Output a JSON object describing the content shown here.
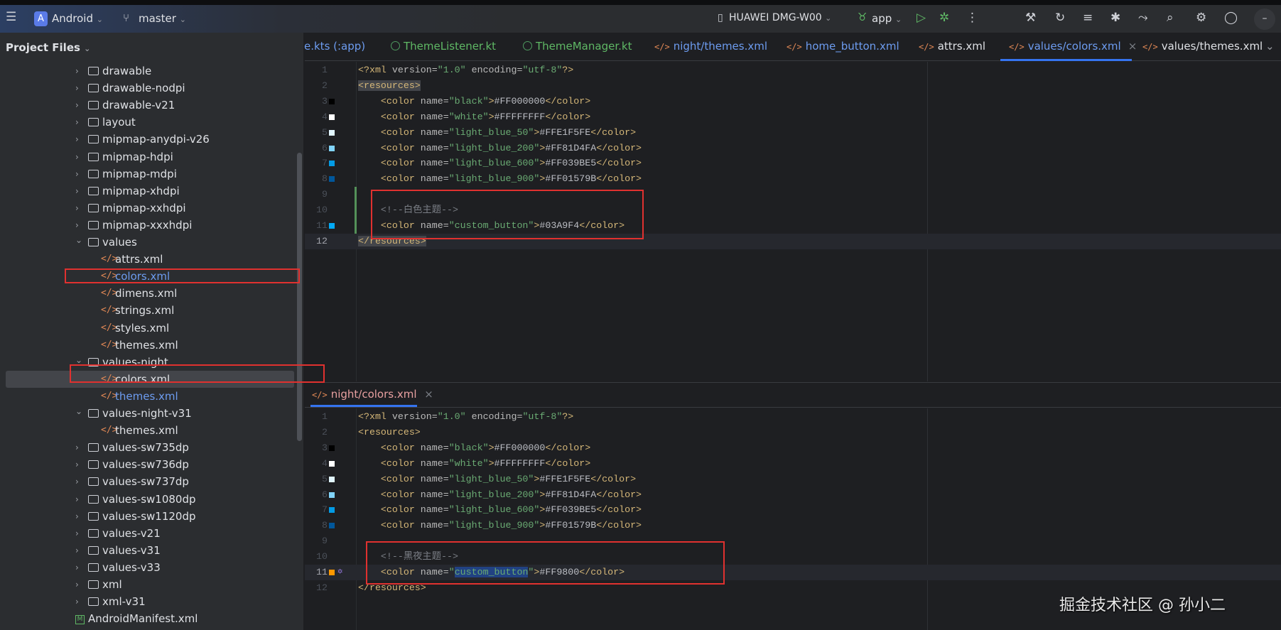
{
  "toolbar": {
    "project_badge": "A",
    "project": "Android",
    "branch": "master",
    "device": "HUAWEI DMG-W00",
    "run_config": "app",
    "more": "⋮"
  },
  "sidebar": {
    "title": "Project Files",
    "items": [
      {
        "label": "drawable",
        "type": "folder",
        "depth": 2
      },
      {
        "label": "drawable-nodpi",
        "type": "folder",
        "depth": 2
      },
      {
        "label": "drawable-v21",
        "type": "folder",
        "depth": 2
      },
      {
        "label": "layout",
        "type": "folder",
        "depth": 2
      },
      {
        "label": "mipmap-anydpi-v26",
        "type": "folder",
        "depth": 2
      },
      {
        "label": "mipmap-hdpi",
        "type": "folder",
        "depth": 2
      },
      {
        "label": "mipmap-mdpi",
        "type": "folder",
        "depth": 2
      },
      {
        "label": "mipmap-xhdpi",
        "type": "folder",
        "depth": 2
      },
      {
        "label": "mipmap-xxhdpi",
        "type": "folder",
        "depth": 2
      },
      {
        "label": "mipmap-xxxhdpi",
        "type": "folder",
        "depth": 2
      },
      {
        "label": "values",
        "type": "folder",
        "depth": 2,
        "open": true
      },
      {
        "label": "attrs.xml",
        "type": "xml",
        "depth": 3
      },
      {
        "label": "colors.xml",
        "type": "xml",
        "depth": 3,
        "color": "#6d9cf0"
      },
      {
        "label": "dimens.xml",
        "type": "xml",
        "depth": 3
      },
      {
        "label": "strings.xml",
        "type": "xml",
        "depth": 3
      },
      {
        "label": "styles.xml",
        "type": "xml",
        "depth": 3
      },
      {
        "label": "themes.xml",
        "type": "xml",
        "depth": 3
      },
      {
        "label": "values-night",
        "type": "folder",
        "depth": 2,
        "open": true
      },
      {
        "label": "colors.xml",
        "type": "xml",
        "depth": 3,
        "selected": true
      },
      {
        "label": "themes.xml",
        "type": "xml",
        "depth": 3,
        "color": "#6d9cf0"
      },
      {
        "label": "values-night-v31",
        "type": "folder",
        "depth": 2,
        "open": true
      },
      {
        "label": "themes.xml",
        "type": "xml",
        "depth": 3
      },
      {
        "label": "values-sw735dp",
        "type": "folder",
        "depth": 2
      },
      {
        "label": "values-sw736dp",
        "type": "folder",
        "depth": 2
      },
      {
        "label": "values-sw737dp",
        "type": "folder",
        "depth": 2
      },
      {
        "label": "values-sw1080dp",
        "type": "folder",
        "depth": 2
      },
      {
        "label": "values-sw1120dp",
        "type": "folder",
        "depth": 2
      },
      {
        "label": "values-v21",
        "type": "folder",
        "depth": 2
      },
      {
        "label": "values-v31",
        "type": "folder",
        "depth": 2
      },
      {
        "label": "values-v33",
        "type": "folder",
        "depth": 2
      },
      {
        "label": "xml",
        "type": "folder",
        "depth": 2
      },
      {
        "label": "xml-v31",
        "type": "folder",
        "depth": 2
      },
      {
        "label": "AndroidManifest.xml",
        "type": "manifest",
        "depth": 1
      }
    ]
  },
  "tabs": [
    {
      "label": "e.kts (:app)",
      "icon": "none",
      "color": "#6d9cf0"
    },
    {
      "label": "ThemeListener.kt",
      "icon": "kotlin",
      "color": "#5fb865"
    },
    {
      "label": "ThemeManager.kt",
      "icon": "kotlin",
      "color": "#5fb865"
    },
    {
      "label": "night/themes.xml",
      "icon": "xml",
      "color": "#6d9cf0"
    },
    {
      "label": "home_button.xml",
      "icon": "xml",
      "color": "#6d9cf0"
    },
    {
      "label": "attrs.xml",
      "icon": "xml",
      "color": "#dfe1e5"
    },
    {
      "label": "values/colors.xml",
      "icon": "xml",
      "color": "#6d9cf0",
      "active": true,
      "close": "×"
    },
    {
      "label": "values/themes.xml",
      "icon": "xml",
      "color": "#dfe1e5"
    }
  ],
  "top_editor": {
    "lines": [
      "<?xml version=\"1.0\" encoding=\"utf-8\"?>",
      "<resources>",
      "    <color name=\"black\">#FF000000</color>",
      "    <color name=\"white\">#FFFFFFFF</color>",
      "    <color name=\"light_blue_50\">#FFE1F5FE</color>",
      "    <color name=\"light_blue_200\">#FF81D4FA</color>",
      "    <color name=\"light_blue_600\">#FF039BE5</color>",
      "    <color name=\"light_blue_900\">#FF01579B</color>",
      "",
      "    <!--白色主题-->",
      "    <color name=\"custom_button\">#03A9F4</color>",
      "</resources>"
    ],
    "swatches": [
      null,
      null,
      "#000000",
      "#FFFFFF",
      "#E1F5FE",
      "#81D4FA",
      "#039BE5",
      "#01579B",
      null,
      null,
      "#03A9F4",
      null
    ],
    "current_line": 12
  },
  "bottom_tab": {
    "label": "night/colors.xml",
    "close": "×"
  },
  "bottom_editor": {
    "lines": [
      "<?xml version=\"1.0\" encoding=\"utf-8\"?>",
      "<resources>",
      "    <color name=\"black\">#FF000000</color>",
      "    <color name=\"white\">#FFFFFFFF</color>",
      "    <color name=\"light_blue_50\">#FFE1F5FE</color>",
      "    <color name=\"light_blue_200\">#FF81D4FA</color>",
      "    <color name=\"light_blue_600\">#FF039BE5</color>",
      "    <color name=\"light_blue_900\">#FF01579B</color>",
      "",
      "    <!--黑夜主题-->",
      "    <color name=\"custom_button\">#FF9800</color>",
      "</resources>"
    ],
    "swatches": [
      null,
      null,
      "#000000",
      "#FFFFFF",
      "#E1F5FE",
      "#81D4FA",
      "#039BE5",
      "#01579B",
      null,
      null,
      "#FF9800",
      null
    ],
    "current_line": 11,
    "selection": "custom_button"
  },
  "watermark": "掘金技术社区 @ 孙小二"
}
